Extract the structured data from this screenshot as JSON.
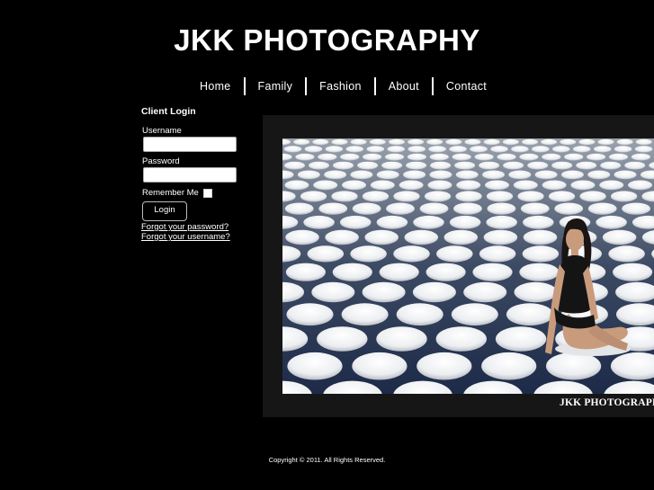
{
  "site": {
    "title": "JKK PHOTOGRAPHY"
  },
  "nav": {
    "items": [
      {
        "label": "Home"
      },
      {
        "label": "Family"
      },
      {
        "label": "Fashion"
      },
      {
        "label": "About"
      },
      {
        "label": "Contact"
      }
    ]
  },
  "login": {
    "heading": "Client Login",
    "username_label": "Username",
    "username_value": "",
    "password_label": "Password",
    "password_value": "",
    "remember_label": "Remember Me",
    "remember_checked": false,
    "button_label": "Login",
    "forgot_password": "Forgot your password?",
    "forgot_username": "Forgot your username?"
  },
  "gallery": {
    "watermark": "JKK PHOTOGRAPHY"
  },
  "footer": {
    "copyright": "Copyright © 2011. All Rights Reserved."
  }
}
